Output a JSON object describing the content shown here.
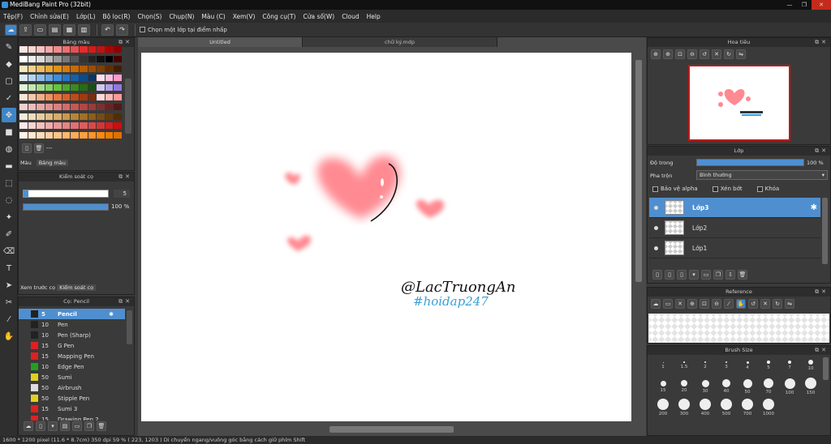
{
  "window": {
    "title": "MediBang Paint Pro (32bit)"
  },
  "menu": [
    "Tệp(F)",
    "Chỉnh sửa(E)",
    "Lớp(L)",
    "Bộ lọc(R)",
    "Chọn(S)",
    "Chụp(N)",
    "Màu (C)",
    "Xem(V)",
    "Công cụ(T)",
    "Cửa sổ(W)",
    "Cloud",
    "Help"
  ],
  "toolbar": {
    "select_layer_label": "Chọn một lớp tại điểm nhấp"
  },
  "color_palette": {
    "title": "Bảng màu",
    "add_more": "---",
    "tab_color": "Màu",
    "tab_palette": "Bảng màu"
  },
  "brush_control": {
    "title": "Kiểm soát cọ",
    "size_value": "5",
    "opacity_value": "100 %",
    "opacity_fraction": 1.0,
    "tab_preview": "Xem trước cọ",
    "tab_control": "Kiểm soát cọ"
  },
  "brush_list": {
    "title": "Cọ: Pencil",
    "items": [
      {
        "size": "5",
        "name": "Pencil",
        "color": "#222222",
        "selected": true
      },
      {
        "size": "10",
        "name": "Pen",
        "color": "#222222"
      },
      {
        "size": "10",
        "name": "Pen (Sharp)",
        "color": "#222222"
      },
      {
        "size": "15",
        "name": "G Pen",
        "color": "#e02020"
      },
      {
        "size": "15",
        "name": "Mapping Pen",
        "color": "#e02020"
      },
      {
        "size": "10",
        "name": "Edge Pen",
        "color": "#20a020"
      },
      {
        "size": "50",
        "name": "Sumi",
        "color": "#e0d020"
      },
      {
        "size": "50",
        "name": "Airbrush",
        "color": "#dddddd"
      },
      {
        "size": "50",
        "name": "Stipple Pen",
        "color": "#e0d020"
      },
      {
        "size": "15",
        "name": "Sumi 3",
        "color": "#e02020"
      },
      {
        "size": "15",
        "name": "Drawing Pen 2",
        "color": "#e02020"
      }
    ]
  },
  "canvas": {
    "tabs": [
      "Untitled",
      "chữ ký.mdp"
    ],
    "signature_line1": "@LacTruongAn",
    "signature_line2": "#hoidap247"
  },
  "navigator": {
    "title": "Hoa tiêu"
  },
  "layers": {
    "title": "Lớp",
    "opacity_label": "Độ trong",
    "opacity_value": "100 %",
    "blend_label": "Pha trộn",
    "blend_value": "Bình thường",
    "protect_alpha": "Bảo vệ alpha",
    "clipping": "Xén bớt",
    "lock": "Khóa",
    "items": [
      {
        "name": "Lớp3",
        "selected": true
      },
      {
        "name": "Lớp2"
      },
      {
        "name": "Lớp1"
      }
    ]
  },
  "reference": {
    "title": "Reference"
  },
  "brush_size": {
    "title": "Brush Size",
    "sizes": [
      "1",
      "1.5",
      "2",
      "3",
      "4",
      "5",
      "7",
      "10",
      "15",
      "20",
      "30",
      "40",
      "50",
      "70",
      "100",
      "150",
      "200",
      "300",
      "400",
      "500",
      "700",
      "1000"
    ]
  },
  "status": {
    "text": "1600 * 1200 pixel   (11.6 * 8.7cm)   350 dpi   59 %   ( 223, 1203 )   Di chuyển ngang/vuông góc bằng cách giữ phím Shift"
  }
}
